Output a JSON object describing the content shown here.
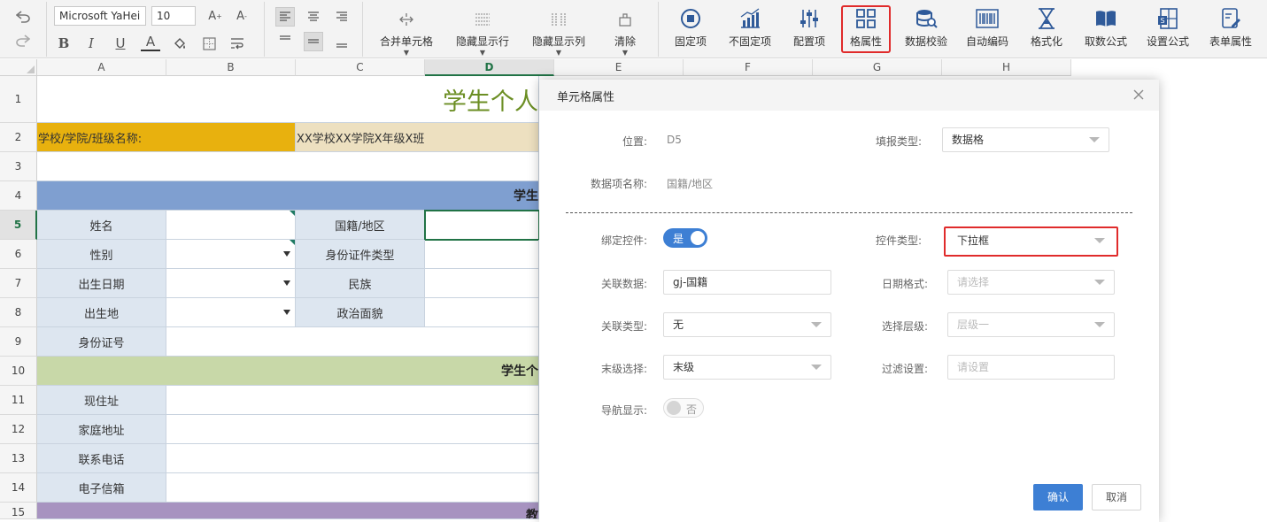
{
  "toolbar": {
    "font_name": "Microsoft YaHei",
    "font_size": "10",
    "merge_cells": "合并单元格",
    "hide_show_rows": "隐藏显示行",
    "hide_show_cols": "隐藏显示列",
    "clear": "清除",
    "tools": [
      "固定项",
      "不固定项",
      "配置项",
      "格属性",
      "数据校验",
      "自动编码",
      "格式化",
      "取数公式",
      "设置公式",
      "表单属性"
    ],
    "highlight_color": "#e02b2b"
  },
  "sheet": {
    "columns": [
      "A",
      "B",
      "C",
      "D",
      "E",
      "F",
      "G",
      "H"
    ],
    "rows": [
      "1",
      "2",
      "3",
      "4",
      "5",
      "6",
      "7",
      "8",
      "9",
      "10",
      "11",
      "12",
      "13",
      "14",
      "15"
    ],
    "active_cell": "D5",
    "title": "学生个人",
    "school_label": "学校/学院/班级名称:",
    "school_value": "XX学校XX学院X年级X班",
    "section1": "学生",
    "section2": "学生个",
    "section3": "教",
    "labels": {
      "name": "姓名",
      "nationality": "国籍/地区",
      "gender": "性别",
      "id_type": "身份证件类型",
      "birth_date": "出生日期",
      "ethnicity": "民族",
      "birthplace": "出生地",
      "political": "政治面貌",
      "id_number": "身份证号",
      "address": "现住址",
      "home_address": "家庭地址",
      "phone": "联系电话",
      "email": "电子信箱"
    },
    "colors": {
      "title_text": "#6b8e23",
      "school_label_bg": "#e8b10e",
      "school_value_bg": "#ede0c0",
      "section1_bg": "#7f9fd0",
      "section2_bg": "#c8d8a8",
      "section3_bg": "#a793c0",
      "label_bg": "#dde6f0"
    }
  },
  "dialog": {
    "title": "单元格属性",
    "position_label": "位置:",
    "position_value": "D5",
    "fill_type_label": "填报类型:",
    "fill_type_value": "数据格",
    "data_item_label": "数据项名称:",
    "data_item_value": "国籍/地区",
    "bind_control_label": "绑定控件:",
    "bind_control_value": "是",
    "control_type_label": "控件类型:",
    "control_type_value": "下拉框",
    "related_data_label": "关联数据:",
    "related_data_value": "gj-国籍",
    "date_format_label": "日期格式:",
    "date_format_placeholder": "请选择",
    "related_type_label": "关联类型:",
    "related_type_value": "无",
    "select_level_label": "选择层级:",
    "select_level_placeholder": "层级一",
    "leaf_select_label": "末级选择:",
    "leaf_select_value": "末级",
    "filter_label": "过滤设置:",
    "filter_placeholder": "请设置",
    "nav_display_label": "导航显示:",
    "nav_display_value": "否",
    "confirm": "确认",
    "cancel": "取消",
    "accent_color": "#3d7fd4"
  }
}
